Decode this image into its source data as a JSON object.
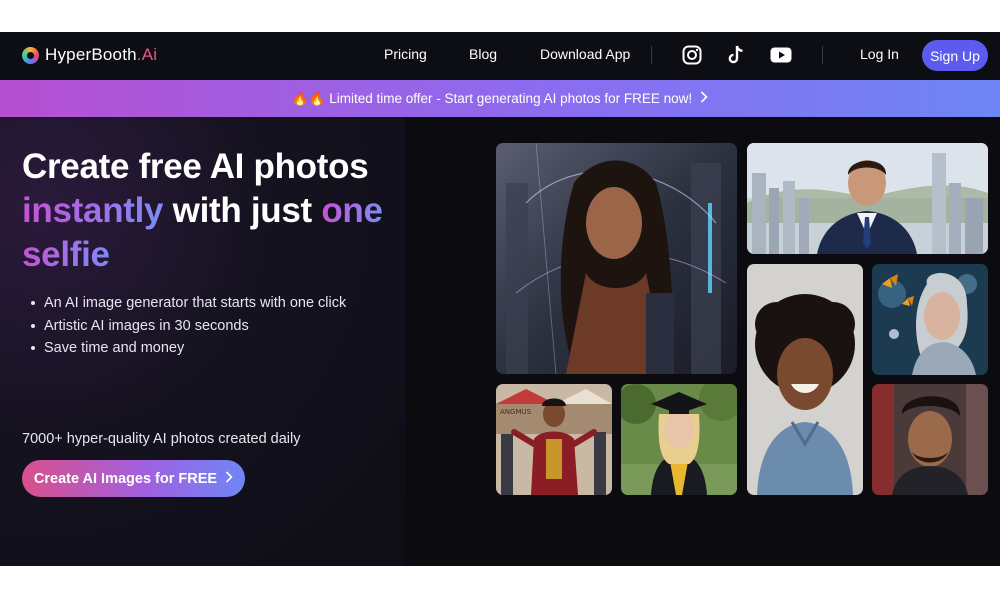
{
  "brand": {
    "name": "HyperBooth",
    "suffix": ".Ai"
  },
  "nav": {
    "links": [
      "Pricing",
      "Blog",
      "Download App"
    ],
    "social": [
      "instagram-icon",
      "tiktok-icon",
      "youtube-icon"
    ],
    "login": "Log In",
    "signup": "Sign Up"
  },
  "banner": {
    "emoji": "🔥🔥",
    "text": "Limited time offer - Start generating AI photos for FREE now!"
  },
  "hero": {
    "line1": "Create free AI photos",
    "line2_a": "instantly",
    "line2_b": " with just ",
    "line2_c": "one",
    "line3": "selfie",
    "bullets": [
      "An AI image generator that starts with one click",
      "Artistic AI images in 30 seconds",
      "Save time and money"
    ],
    "stat": "7000+ hyper-quality AI photos created daily",
    "cta": "Create AI Images for FREE"
  },
  "colors": {
    "accent": "#5b5bf0",
    "gradient_start": "#c653d6",
    "gradient_end": "#7d8bf5"
  }
}
